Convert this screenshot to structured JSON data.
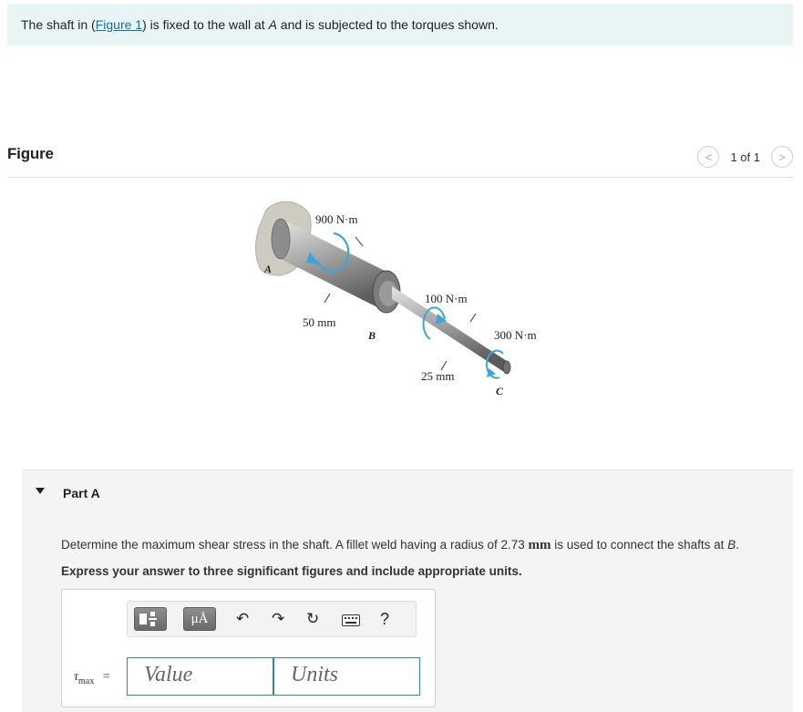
{
  "intro": {
    "before": "The shaft in (",
    "link": "Figure 1",
    "after": ") is fixed to the wall at ",
    "point": "A",
    "end": " and is subjected to the torques shown."
  },
  "figure": {
    "title": "Figure",
    "pager": {
      "prev": "<",
      "text": "1 of 1",
      "next": ">"
    },
    "labels": {
      "torque_a": "900 N·m",
      "torque_b": "100 N·m",
      "torque_c": "300 N·m",
      "dia_large": "50 mm",
      "dia_small": "25 mm",
      "point_a": "A",
      "point_b": "B",
      "point_c": "C"
    }
  },
  "part": {
    "title": "Part A",
    "question_pre": "Determine the maximum shear stress in the shaft. A fillet weld having a radius of 2.73 ",
    "question_unit": "mm",
    "question_post": " is used to connect the shafts at ",
    "question_point": "B",
    "question_end": ".",
    "instruction": "Express your answer to three significant figures and include appropriate units."
  },
  "answer": {
    "toolbar": {
      "mu_label": "μÅ",
      "undo_icon": "↶",
      "redo_icon": "↷",
      "reset_icon": "↻",
      "keyboard_icon": "keyboard-icon",
      "help_label": "?"
    },
    "symbol": "τ",
    "symbol_sub": "max",
    "equals": "=",
    "value_placeholder": "Value",
    "units_placeholder": "Units"
  }
}
